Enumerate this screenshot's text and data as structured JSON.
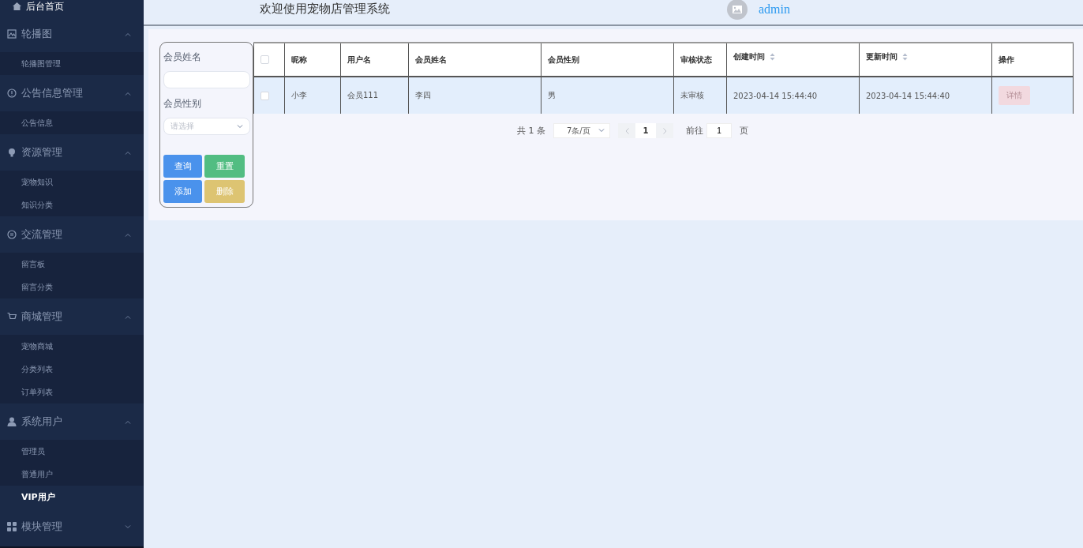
{
  "sidebar": {
    "home": {
      "label": "后台首页"
    },
    "groups": [
      {
        "title": "轮播图",
        "expanded": true,
        "children": [
          {
            "label": "轮播图管理",
            "selected": false
          }
        ]
      },
      {
        "title": "公告信息管理",
        "expanded": true,
        "children": [
          {
            "label": "公告信息",
            "selected": false
          }
        ]
      },
      {
        "title": "资源管理",
        "expanded": true,
        "children": [
          {
            "label": "宠物知识",
            "selected": false
          },
          {
            "label": "知识分类",
            "selected": false
          }
        ]
      },
      {
        "title": "交流管理",
        "expanded": true,
        "children": [
          {
            "label": "留言板",
            "selected": false
          },
          {
            "label": "留言分类",
            "selected": false
          }
        ]
      },
      {
        "title": "商城管理",
        "expanded": true,
        "children": [
          {
            "label": "宠物商城",
            "selected": false
          },
          {
            "label": "分类列表",
            "selected": false
          },
          {
            "label": "订单列表",
            "selected": false
          }
        ]
      },
      {
        "title": "系统用户",
        "expanded": true,
        "children": [
          {
            "label": "管理员",
            "selected": false
          },
          {
            "label": "普通用户",
            "selected": false
          },
          {
            "label": "VIP用户",
            "selected": true
          }
        ]
      },
      {
        "title": "模块管理",
        "expanded": false
      }
    ]
  },
  "header": {
    "title": "欢迎使用宠物店管理系统",
    "user": "admin"
  },
  "filters": [
    {
      "kind": "text",
      "label": "会员姓名"
    },
    {
      "kind": "select",
      "label": "会员性别",
      "placeholder": "请选择"
    }
  ],
  "buttons": [
    {
      "label": "查询",
      "color": "#4a92ec"
    },
    {
      "label": "重置",
      "color": "#52bd82"
    },
    {
      "label": "添加",
      "color": "#4a92ec"
    },
    {
      "label": "删除",
      "color": "#ddc472"
    }
  ],
  "table": {
    "select_all": {
      "checked": false
    },
    "columns": [
      {
        "label": "昵称",
        "sortable": false
      },
      {
        "label": "用户名",
        "sortable": false
      },
      {
        "label": "会员姓名",
        "sortable": false
      },
      {
        "label": "会员性别",
        "sortable": false
      },
      {
        "label": "审核状态",
        "sortable": false
      },
      {
        "label": "创建时间",
        "sortable": true
      },
      {
        "label": "更新时间",
        "sortable": true
      },
      {
        "label": "操作",
        "sortable": false
      }
    ],
    "rows": [
      {
        "checked": false,
        "cells": [
          "小李",
          "会员111",
          "李四",
          "男",
          "未审核",
          "2023-04-14 15:44:40",
          "2023-04-14 15:44:40"
        ],
        "action": "详情"
      }
    ]
  },
  "pagination": {
    "total": "共 1 条",
    "page_size": "7条/页",
    "pages": [
      {
        "label": "1",
        "selected": true
      }
    ],
    "goto_label": "前往",
    "goto_value": "1",
    "unit": "页"
  }
}
